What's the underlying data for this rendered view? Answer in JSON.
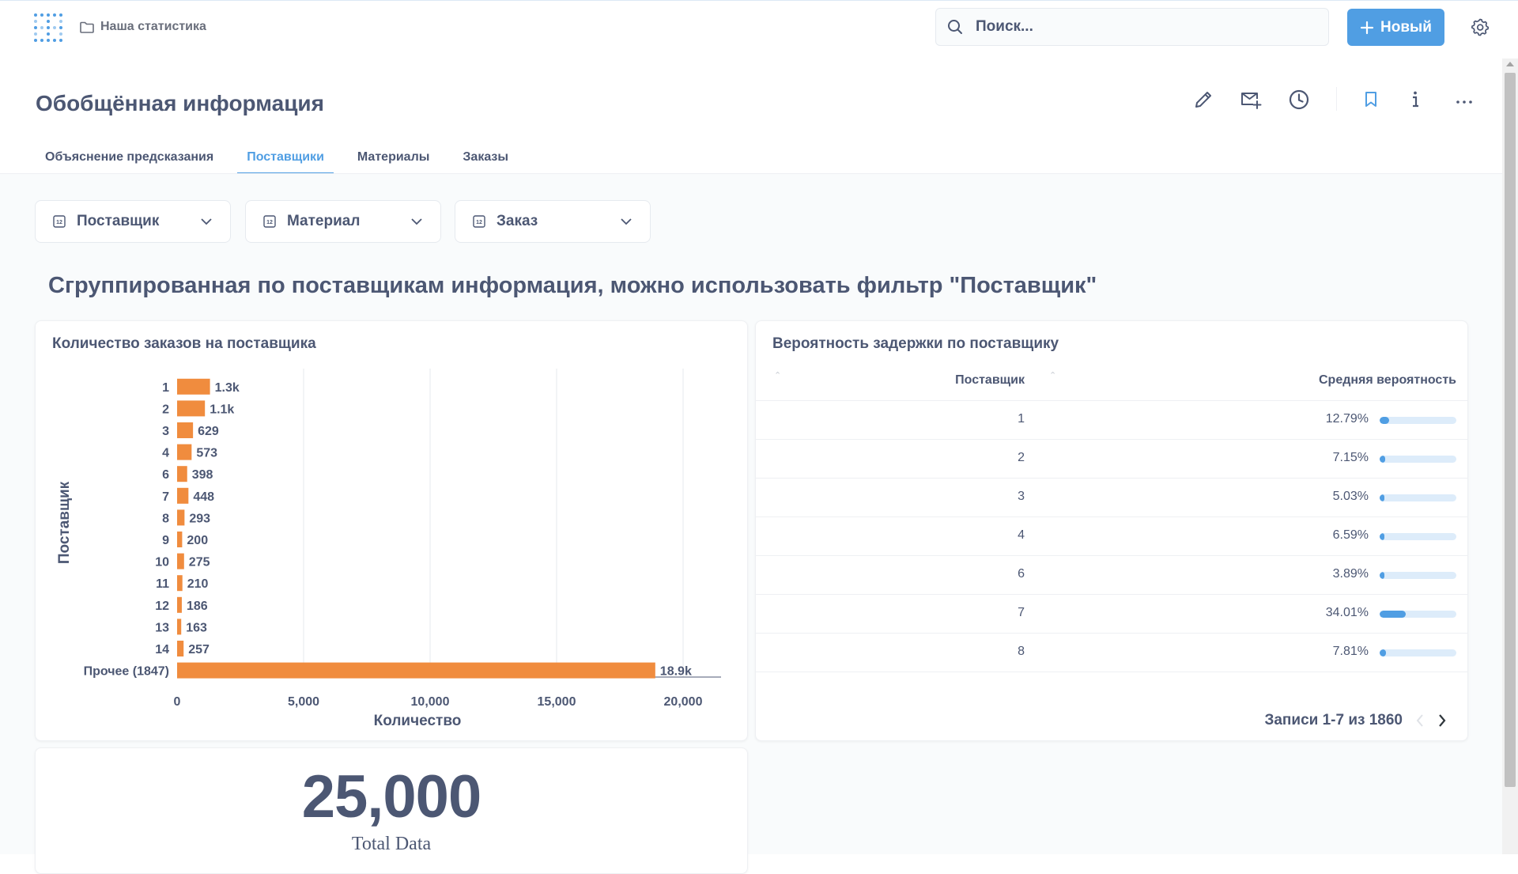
{
  "header": {
    "breadcrumb": "Наша статистика",
    "search_placeholder": "Поиск...",
    "new_button": "Новый"
  },
  "page": {
    "title": "Обобщённая информация",
    "tabs": [
      {
        "label": "Объяснение предсказания",
        "active": false
      },
      {
        "label": "Поставщики",
        "active": true
      },
      {
        "label": "Материалы",
        "active": false
      },
      {
        "label": "Заказы",
        "active": false
      }
    ]
  },
  "filters": [
    {
      "label": "Поставщик"
    },
    {
      "label": "Материал"
    },
    {
      "label": "Заказ"
    }
  ],
  "section_heading": "Сгруппированная по поставщикам информация, можно использовать фильтр \"Поставщик\"",
  "orders_card": {
    "title": "Количество заказов на поставщика"
  },
  "chart_data": {
    "type": "bar",
    "orientation": "horizontal",
    "title": "Количество заказов на поставщика",
    "xlabel": "Количество",
    "ylabel": "Поставщик",
    "categories": [
      "1",
      "2",
      "3",
      "4",
      "6",
      "7",
      "8",
      "9",
      "10",
      "11",
      "12",
      "13",
      "14",
      "Прочее (1847)"
    ],
    "values": [
      1300,
      1100,
      629,
      573,
      398,
      448,
      293,
      200,
      275,
      210,
      186,
      163,
      257,
      18900
    ],
    "data_labels": [
      "1.3k",
      "1.1k",
      "629",
      "573",
      "398",
      "448",
      "293",
      "200",
      "275",
      "210",
      "186",
      "163",
      "257",
      "18.9k"
    ],
    "xlim": [
      0,
      21500
    ],
    "xticks": [
      0,
      5000,
      10000,
      15000,
      20000
    ],
    "xtick_labels": [
      "0",
      "5,000",
      "10,000",
      "15,000",
      "20,000"
    ],
    "grid": "vertical",
    "color": "#f08c3e"
  },
  "delay_card": {
    "title": "Вероятность задержки по поставщику",
    "col_supplier": "Поставщик",
    "col_prob": "Средняя вероятность",
    "rows": [
      {
        "id": "1",
        "pct": "12.79%",
        "value": 0.1279
      },
      {
        "id": "2",
        "pct": "7.15%",
        "value": 0.0715
      },
      {
        "id": "3",
        "pct": "5.03%",
        "value": 0.0503
      },
      {
        "id": "4",
        "pct": "6.59%",
        "value": 0.0659
      },
      {
        "id": "6",
        "pct": "3.89%",
        "value": 0.0389
      },
      {
        "id": "7",
        "pct": "34.01%",
        "value": 0.3401
      },
      {
        "id": "8",
        "pct": "7.81%",
        "value": 0.0781
      }
    ],
    "pager": "Записи 1-7 из 1860"
  },
  "total_card": {
    "value": "25,000",
    "label": "Total Data"
  },
  "colors": {
    "accent": "#509ee3",
    "bar": "#f08c3e",
    "text": "#4c5773"
  }
}
